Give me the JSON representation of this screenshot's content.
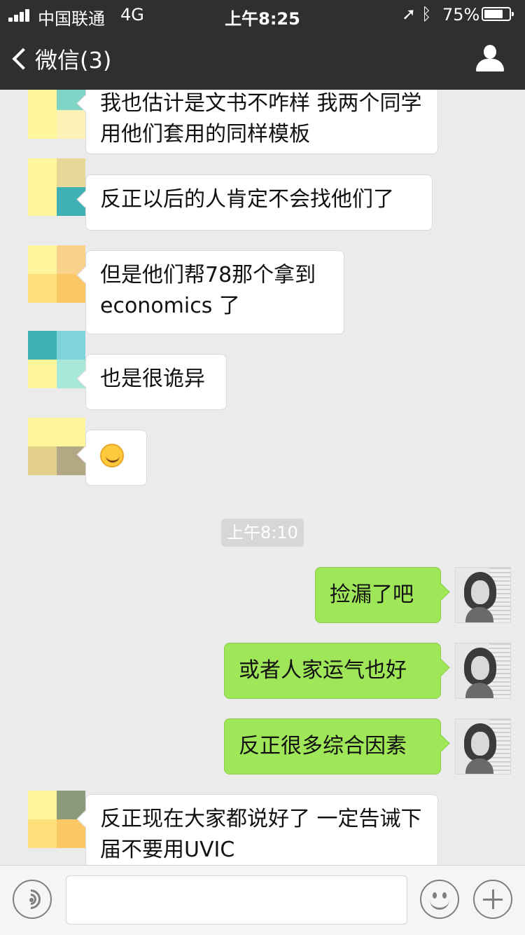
{
  "status_bar": {
    "carrier": "中国联通",
    "network": "4G",
    "time": "上午8:25",
    "location_icon": "location-arrow-icon",
    "bluetooth_icon": "bluetooth-icon",
    "battery": "75%",
    "battery_level": 0.75
  },
  "nav": {
    "back_label": "微信(3)",
    "profile_icon": "person-icon"
  },
  "messages": [
    {
      "side": "received",
      "text": "我也估计是文书不咋样 我两个同学用他们套用的同样模板"
    },
    {
      "side": "received",
      "text": "反正以后的人肯定不会找他们了"
    },
    {
      "side": "received",
      "text": "但是他们帮78那个拿到economics 了"
    },
    {
      "side": "received",
      "text": "也是很诡异"
    },
    {
      "side": "received",
      "text": "",
      "emoji": "face-palm-emoji"
    },
    {
      "side": "timestamp",
      "text": "上午8:10"
    },
    {
      "side": "sent",
      "text": "捡漏了吧"
    },
    {
      "side": "sent",
      "text": "或者人家运气也好"
    },
    {
      "side": "sent",
      "text": "反正很多综合因素"
    },
    {
      "side": "received",
      "text": "反正现在大家都说好了 一定告诫下届不要用UVIC"
    }
  ],
  "input_bar": {
    "voice_icon": "voice-icon",
    "input_value": "",
    "emoji_icon": "smiley-icon",
    "plus_icon": "plus-icon"
  },
  "colors": {
    "bar_bg": "#2f2f31",
    "chat_bg": "#ebebeb",
    "sent_bubble": "#9fe658",
    "received_bubble": "#ffffff"
  }
}
